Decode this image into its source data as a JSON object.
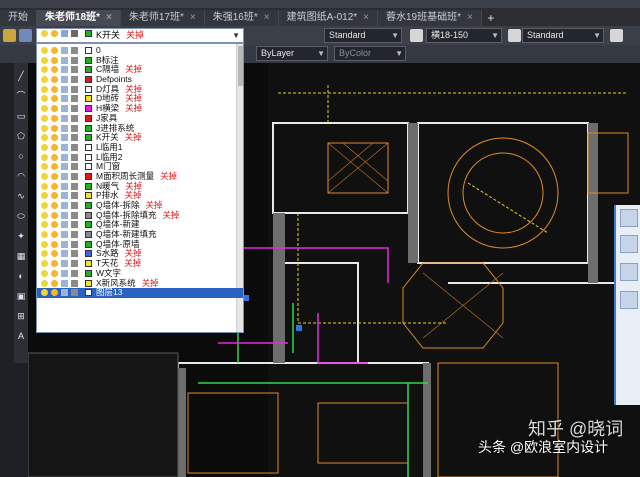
{
  "tabs": [
    {
      "label": "开始",
      "active": false
    },
    {
      "label": "朱老师18班*",
      "active": true
    },
    {
      "label": "朱老师17班*",
      "active": false
    },
    {
      "label": "朱强16班*",
      "active": false
    },
    {
      "label": "建筑图纸A-012*",
      "active": false
    },
    {
      "label": "蓉水19班基础班*",
      "active": false
    }
  ],
  "toolbar": {
    "layer_current": "K开关",
    "layer_current_note": "关掉",
    "text_style": "Standard",
    "dim_style": "横18-150",
    "table_style": "Standard",
    "linetype": "ByLayer",
    "color": "ByColor"
  },
  "layers": [
    {
      "name": "0",
      "note": "",
      "color": "#ffffff"
    },
    {
      "name": "B标注",
      "note": "",
      "color": "#20b020"
    },
    {
      "name": "C隔墙",
      "note": "关掉",
      "color": "#20b020"
    },
    {
      "name": "Defpoints",
      "note": "",
      "color": "#e0191a"
    },
    {
      "name": "D灯具",
      "note": "关掉",
      "color": "#ffffff"
    },
    {
      "name": "D地砖",
      "note": "关掉",
      "color": "#f2e21c"
    },
    {
      "name": "H横梁",
      "note": "关掉",
      "color": "#e01fd6"
    },
    {
      "name": "J家具",
      "note": "",
      "color": "#e0191a"
    },
    {
      "name": "J进排系统",
      "note": "",
      "color": "#20b020"
    },
    {
      "name": "K开关",
      "note": "关掉",
      "color": "#20b020"
    },
    {
      "name": "L临用1",
      "note": "",
      "color": "#ffffff"
    },
    {
      "name": "L临用2",
      "note": "",
      "color": "#ffffff"
    },
    {
      "name": "M门窗",
      "note": "",
      "color": "#ffffff"
    },
    {
      "name": "M面积周长测量",
      "note": "关掉",
      "color": "#e0191a"
    },
    {
      "name": "N暖气",
      "note": "关掉",
      "color": "#20b020"
    },
    {
      "name": "P排水",
      "note": "关掉",
      "color": "#f2e21c"
    },
    {
      "name": "Q墙体-拆除",
      "note": "关掉",
      "color": "#20b020"
    },
    {
      "name": "Q墙体-拆除填充",
      "note": "关掉",
      "color": "#8a8a8a"
    },
    {
      "name": "Q墙体-新建",
      "note": "",
      "color": "#20b020"
    },
    {
      "name": "Q墙体-新建填充",
      "note": "",
      "color": "#8a8a8a"
    },
    {
      "name": "Q墙体-原墙",
      "note": "",
      "color": "#20b020"
    },
    {
      "name": "S水路",
      "note": "关掉",
      "color": "#3f63e0"
    },
    {
      "name": "T天花",
      "note": "关掉",
      "color": "#f2e21c"
    },
    {
      "name": "W文字",
      "note": "",
      "color": "#20b020"
    },
    {
      "name": "X新风系统",
      "note": "关掉",
      "color": "#f2e21c"
    },
    {
      "name": "图层13",
      "note": "",
      "color": "#ffffff"
    }
  ],
  "selected_layer": "图层13",
  "watermark": {
    "primary": "头条 @欧浪室内设计",
    "secondary": "知乎 @晓词"
  }
}
